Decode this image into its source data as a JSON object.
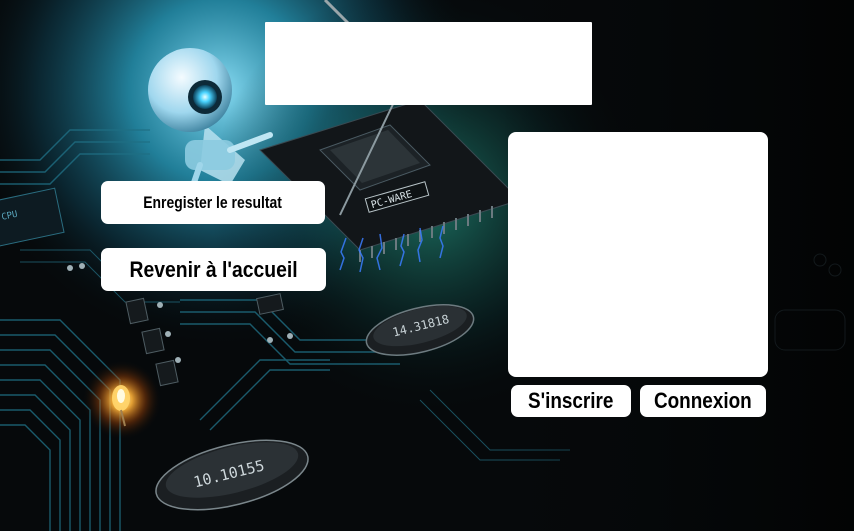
{
  "buttons": {
    "save_result": "Enregister le resultat",
    "back_home": "Revenir à l'accueil",
    "sign_up": "S'inscrire",
    "login": "Connexion"
  },
  "background": {
    "chip_label": "PC-WARE",
    "crystal_label_1": "14.31818",
    "crystal_label_2": "10.10155",
    "cpu_label": "CPU"
  }
}
